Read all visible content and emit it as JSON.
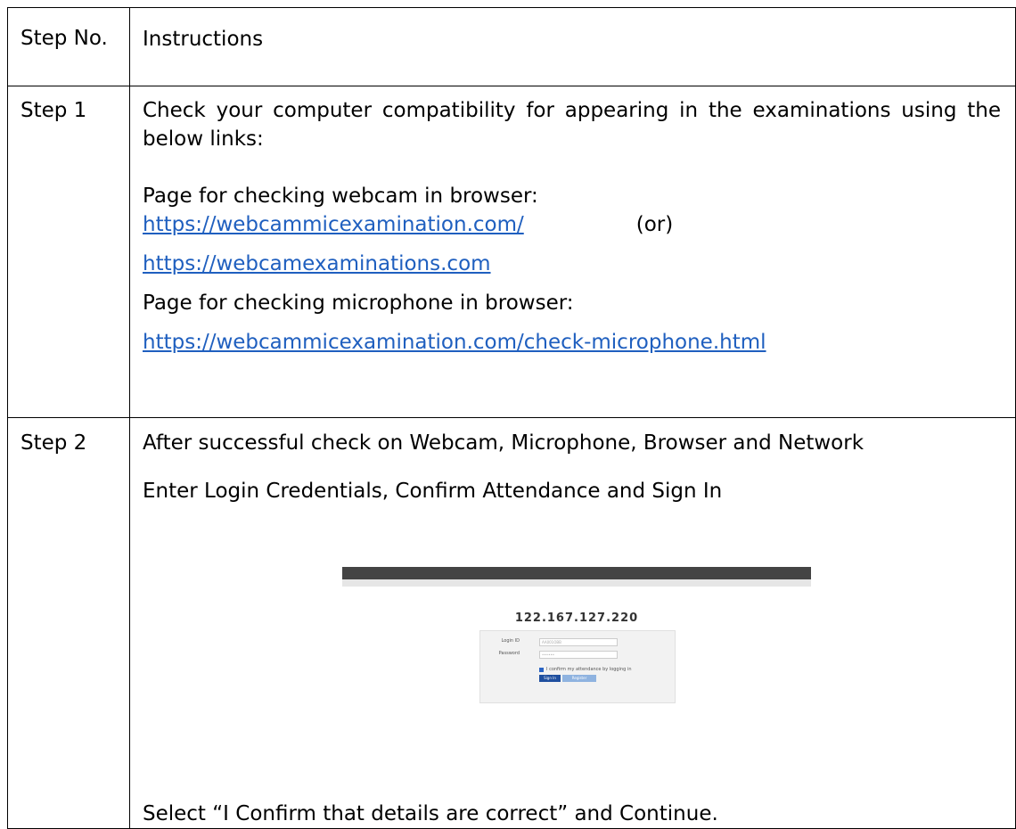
{
  "table": {
    "header": {
      "step_no": "Step No.",
      "instructions": "Instructions"
    },
    "step1": {
      "label": "Step 1",
      "intro": "Check your computer compatibility for appearing in the examinations using the below links:",
      "webcam_heading": "Page for checking webcam in browser:",
      "webcam_link_1": "https://webcammicexamination.com/",
      "or_text": "(or)",
      "webcam_link_2": "https://webcamexaminations.com",
      "mic_heading": "Page for checking microphone in browser:",
      "mic_link": "https://webcammicexamination.com/check-microphone.html"
    },
    "step2": {
      "label": "Step 2",
      "line1": "After successful check on Webcam, Microphone, Browser and Network",
      "line2": "Enter Login Credentials, Confirm Attendance and Sign In",
      "line3": "Select “I Confirm that details are correct” and Continue."
    }
  },
  "login_screenshot": {
    "ip": "122.167.127.220",
    "login_id_label": "Login ID",
    "login_id_value": "AA001OBB",
    "password_label": "Password",
    "password_value": "••••••",
    "confirm_text": "I confirm my attendance by logging in",
    "signin_label": "Sign In",
    "register_label": "Register",
    "colors": {
      "signin": "#1f4f9f",
      "register": "#8fb3e0",
      "topbar": "#444444"
    }
  }
}
